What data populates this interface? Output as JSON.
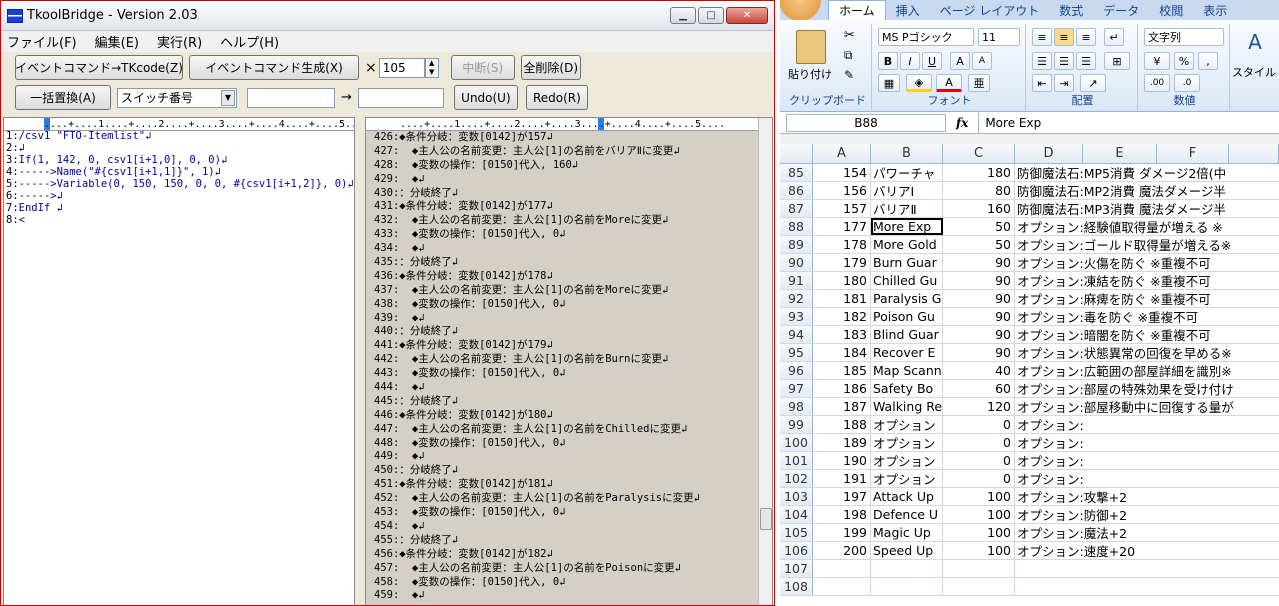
{
  "tk": {
    "title": "TkoolBridge - Version 2.03",
    "menu": [
      "ファイル(F)",
      "編集(E)",
      "実行(R)",
      "ヘルプ(H)"
    ],
    "btn_to_tkcode": "イベントコマンド→TKcode(Z)",
    "btn_generate": "イベントコマンド生成(X)",
    "times": "×",
    "count": "105",
    "btn_abort": "中断(S)",
    "btn_clear": "全削除(D)",
    "btn_replace": "一括置換(A)",
    "select_value": "スイッチ番号",
    "replace_arrow": "→",
    "btn_undo": "Undo(U)",
    "btn_redo": "Redo(R)",
    "ruler": "....+....1....+....2....+....3....+....4....+....5....",
    "left_lines": [
      {
        "n": "1:",
        "t": "/csv1 \"FTO-Itemlist\"↲"
      },
      {
        "n": "2:",
        "t": "↲"
      },
      {
        "n": "3:",
        "t": "If(1, 142, 0, csv1[i+1,0], 0, 0)↲"
      },
      {
        "n": "4:",
        "t": "----->Name(\"#{csv1[i+1,1]}\", 1)↲"
      },
      {
        "n": "5:",
        "t": "----->Variable(0, 150, 150, 0, 0, #{csv1[i+1,2]}, 0)↲"
      },
      {
        "n": "6:",
        "t": "----->↲"
      },
      {
        "n": "7:",
        "t": "EndIf ↲"
      },
      {
        "n": "8:",
        "t": "<"
      }
    ],
    "right_lines": [
      "426:◆条件分岐：変数[0142]が157↲",
      "427:  ◆主人公の名前変更：主人公[1]の名前をバリアⅡに変更↲",
      "428:  ◆変数の操作：[0150]代入, 160↲",
      "429:  ◆↲",
      "430:：分岐終了↲",
      "431:◆条件分岐：変数[0142]が177↲",
      "432:  ◆主人公の名前変更：主人公[1]の名前をMoreに変更↲",
      "433:  ◆変数の操作：[0150]代入, 0↲",
      "434:  ◆↲",
      "435:：分岐終了↲",
      "436:◆条件分岐：変数[0142]が178↲",
      "437:  ◆主人公の名前変更：主人公[1]の名前をMoreに変更↲",
      "438:  ◆変数の操作：[0150]代入, 0↲",
      "439:  ◆↲",
      "440:：分岐終了↲",
      "441:◆条件分岐：変数[0142]が179↲",
      "442:  ◆主人公の名前変更：主人公[1]の名前をBurnに変更↲",
      "443:  ◆変数の操作：[0150]代入, 0↲",
      "444:  ◆↲",
      "445:：分岐終了↲",
      "446:◆条件分岐：変数[0142]が180↲",
      "447:  ◆主人公の名前変更：主人公[1]の名前をChilledに変更↲",
      "448:  ◆変数の操作：[0150]代入, 0↲",
      "449:  ◆↲",
      "450:：分岐終了↲",
      "451:◆条件分岐：変数[0142]が181↲",
      "452:  ◆主人公の名前変更：主人公[1]の名前をParalysisに変更↲",
      "453:  ◆変数の操作：[0150]代入, 0↲",
      "454:  ◆↲",
      "455:：分岐終了↲",
      "456:◆条件分岐：変数[0142]が182↲",
      "457:  ◆主人公の名前変更：主人公[1]の名前をPoisonに変更↲",
      "458:  ◆変数の操作：[0150]代入, 0↲",
      "459:  ◆↲"
    ]
  },
  "xl": {
    "tabs": [
      "ホーム",
      "挿入",
      "ページ レイアウト",
      "数式",
      "データ",
      "校閲",
      "表示"
    ],
    "font_name": "MS Pゴシック",
    "font_size": "11",
    "number_format": "文字列",
    "paste_label": "貼り付け",
    "style_label": "スタイル",
    "group_clipboard": "クリップボード",
    "group_font": "フォント",
    "group_align": "配置",
    "group_number": "数値",
    "name_box": "B88",
    "fx": "fx",
    "formula": "More  Exp",
    "columns": [
      "A",
      "B",
      "C",
      "D",
      "E",
      "F"
    ],
    "rows": [
      {
        "r": "85",
        "a": "154",
        "b": "パワーチャ",
        "c": "180",
        "d": "防御魔法石:MP5消費 ダメージ2倍(中"
      },
      {
        "r": "86",
        "a": "156",
        "b": "バリアⅠ",
        "c": "80",
        "d": "防御魔法石:MP2消費 魔法ダメージ半"
      },
      {
        "r": "87",
        "a": "157",
        "b": "バリアⅡ",
        "c": "160",
        "d": "防御魔法石:MP3消費 魔法ダメージ半"
      },
      {
        "r": "88",
        "a": "177",
        "b": "More  Exp",
        "c": "50",
        "d": "オプション:経験値取得量が増える ※"
      },
      {
        "r": "89",
        "a": "178",
        "b": "More  Gold",
        "c": "50",
        "d": "オプション:ゴールド取得量が増える※"
      },
      {
        "r": "90",
        "a": "179",
        "b": "Burn  Guar",
        "c": "90",
        "d": "オプション:火傷を防ぐ ※重複不可"
      },
      {
        "r": "91",
        "a": "180",
        "b": "Chilled  Gu",
        "c": "90",
        "d": "オプション:凍結を防ぐ ※重複不可"
      },
      {
        "r": "92",
        "a": "181",
        "b": "Paralysis  G",
        "c": "90",
        "d": "オプション:麻痺を防ぐ ※重複不可"
      },
      {
        "r": "93",
        "a": "182",
        "b": "Poison  Gu",
        "c": "90",
        "d": "オプション:毒を防ぐ ※重複不可"
      },
      {
        "r": "94",
        "a": "183",
        "b": "Blind  Guar",
        "c": "90",
        "d": "オプション:暗闇を防ぐ ※重複不可"
      },
      {
        "r": "95",
        "a": "184",
        "b": "Recover  E",
        "c": "90",
        "d": "オプション:状態異常の回復を早める※"
      },
      {
        "r": "96",
        "a": "185",
        "b": "Map  Scann",
        "c": "40",
        "d": "オプション:広範囲の部屋詳細を識別※"
      },
      {
        "r": "97",
        "a": "186",
        "b": "Safety  Bo",
        "c": "60",
        "d": "オプション:部屋の特殊効果を受け付け"
      },
      {
        "r": "98",
        "a": "187",
        "b": "Walking  Re",
        "c": "120",
        "d": "オプション:部屋移動中に回復する量が"
      },
      {
        "r": "99",
        "a": "188",
        "b": "オプション",
        "c": "0",
        "d": "オプション:"
      },
      {
        "r": "100",
        "a": "189",
        "b": "オプション",
        "c": "0",
        "d": "オプション:"
      },
      {
        "r": "101",
        "a": "190",
        "b": "オプション",
        "c": "0",
        "d": "オプション:"
      },
      {
        "r": "102",
        "a": "191",
        "b": "オプション",
        "c": "0",
        "d": "オプション:"
      },
      {
        "r": "103",
        "a": "197",
        "b": "Attack  Up",
        "c": "100",
        "d": "オプション:攻撃+2"
      },
      {
        "r": "104",
        "a": "198",
        "b": "Defence  U",
        "c": "100",
        "d": "オプション:防御+2"
      },
      {
        "r": "105",
        "a": "199",
        "b": "Magic  Up",
        "c": "100",
        "d": "オプション:魔法+2"
      },
      {
        "r": "106",
        "a": "200",
        "b": "Speed  Up",
        "c": "100",
        "d": "オプション:速度+20"
      },
      {
        "r": "107",
        "a": "",
        "b": "",
        "c": "",
        "d": ""
      },
      {
        "r": "108",
        "a": "",
        "b": "",
        "c": "",
        "d": ""
      }
    ]
  }
}
